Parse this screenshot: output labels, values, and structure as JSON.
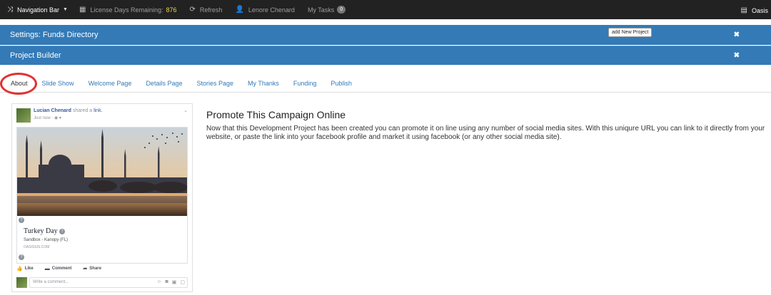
{
  "navbar": {
    "brand_label": "Navigation Bar",
    "license_label": "License Days Remaining:",
    "license_count": "876",
    "refresh_label": "Refresh",
    "user_name": "Lenore Chenard",
    "tasks_label": "My Tasks",
    "tasks_count": "0",
    "right_label": "Oasis"
  },
  "header": {
    "settings_title": "Settings: Funds Directory",
    "add_project_label": "add New Project",
    "builder_title": "Project Builder",
    "close_glyph": "✖"
  },
  "tabs": [
    {
      "label": "About",
      "active": true
    },
    {
      "label": "Slide Show"
    },
    {
      "label": "Welcome Page"
    },
    {
      "label": "Details Page"
    },
    {
      "label": "Stories Page"
    },
    {
      "label": "My Thanks"
    },
    {
      "label": "Funding"
    },
    {
      "label": "Publish"
    }
  ],
  "fb_post": {
    "author": "Lucian Chenard",
    "shared_text": "shared a",
    "link_word": "link.",
    "time": "Just now · ",
    "link_title": "Turkey Day",
    "link_subtitle": "Sandbox - Kanopy (FL)",
    "link_domain": "OASISSIS.COM",
    "like_label": "Like",
    "comment_label": "Comment",
    "share_label": "Share",
    "comment_placeholder": "Write a comment..."
  },
  "promote": {
    "title": "Promote This Campaign Online",
    "body": "Now that this Development Project has been created you can promote it on line using any number of social media sites. With this uniqure URL you can link to it directly from your website, or paste the link into your facebook profile and market it using facebook (or any other social media site)."
  },
  "colors": {
    "navbar_bg": "#222222",
    "header_blue": "#337ab7",
    "tab_link": "#337ab7",
    "highlight_red": "#e03333",
    "license_count": "#f3d24a"
  }
}
